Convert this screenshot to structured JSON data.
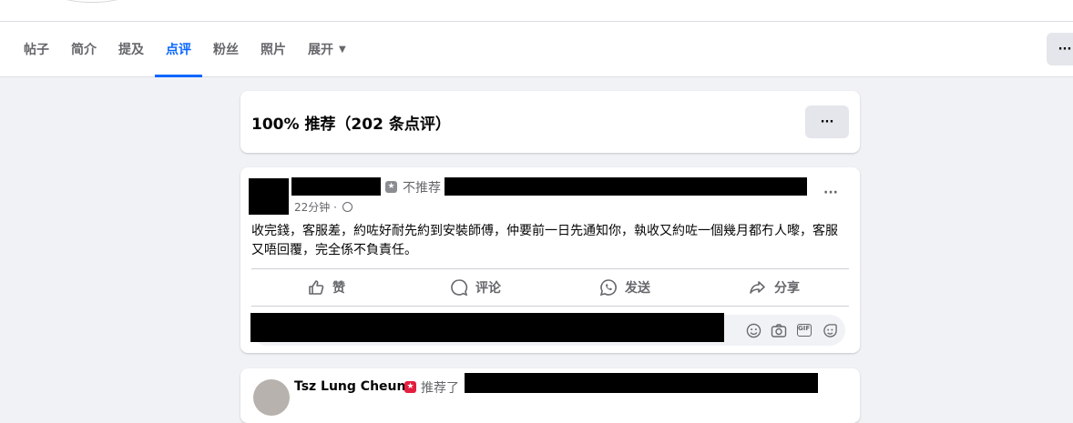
{
  "tabs": [
    {
      "label": "帖子"
    },
    {
      "label": "简介"
    },
    {
      "label": "提及"
    },
    {
      "label": "点评",
      "active": true
    },
    {
      "label": "粉丝"
    },
    {
      "label": "照片"
    },
    {
      "label": "展开",
      "has_caret": true
    }
  ],
  "top_more": "···",
  "summary": {
    "title": "100% 推荐（202 条点评）",
    "more": "···"
  },
  "review1": {
    "recommend_label": "不推荐",
    "time": "22分钟 ·",
    "more": "···",
    "text": "收完錢，客服差，約咗好耐先約到安裝師傅，仲要前一日先通知你，執收又約咗一個幾月都冇人嚟，客服又唔回覆，完全係不負責任。",
    "actions": {
      "like": "赞",
      "comment": "评论",
      "send": "发送",
      "share": "分享"
    },
    "comment_icons": [
      "smile-icon",
      "camera-icon",
      "gif-icon",
      "sticker-icon"
    ]
  },
  "review2": {
    "name": "Tsz Lung Cheung",
    "recommend_label": "推荐了"
  },
  "colors": {
    "accent": "#0866ff",
    "background": "#f0f2f5",
    "muted": "#65676b",
    "recommend": "#e41e3f"
  }
}
